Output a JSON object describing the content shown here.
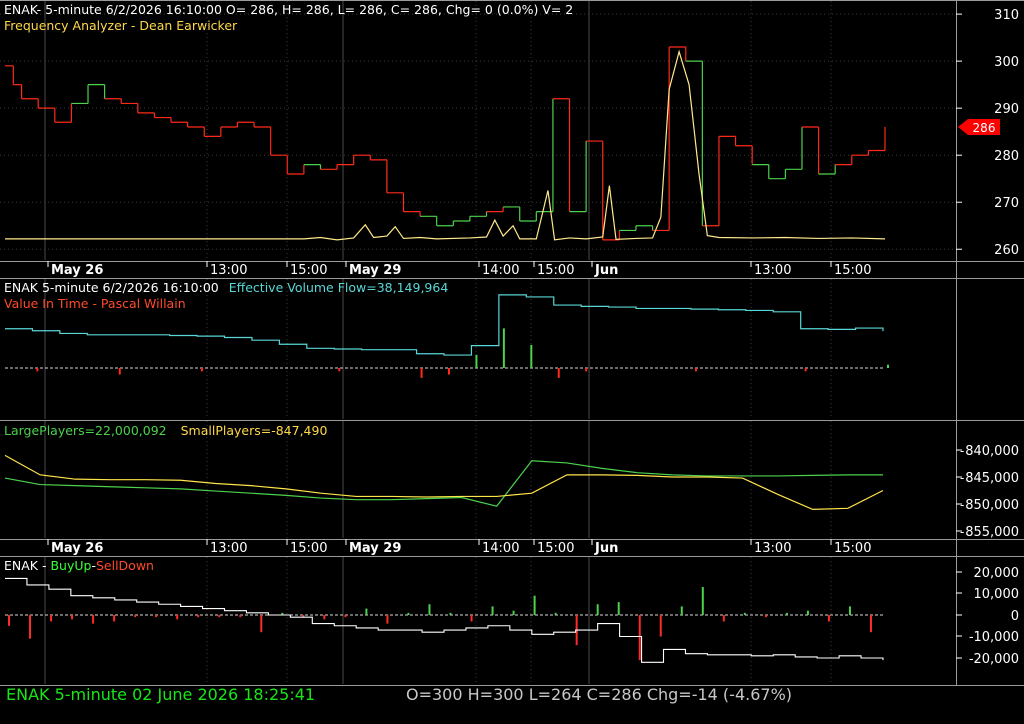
{
  "colors": {
    "background": "#000000",
    "grid": "#3a3a3a",
    "panel_border": "#9a9a9a",
    "axis_text": "#ffffff",
    "price_down": "#ff2a1a",
    "price_up": "#4cd24c",
    "frequency": "#ffe98a",
    "flow": "#5ad6d6",
    "large_players": "#4cd24c",
    "small_players": "#ffe44a",
    "buy_up": "#4cd24c",
    "sell_down": "#ff2a2a",
    "net_line": "#ffffff",
    "price_tag": "#ff0000",
    "status_symbol": "#19e619",
    "status_ohlc": "#c8c8c8"
  },
  "headers": {
    "price_line1": "ENAK- 5-minute 6/2/2026 16:10:00 O= 286, H= 286, L= 286, C= 286, Chg= 0 (0.0%) V= 2",
    "price_line2": "Frequency Analyzer - Dean Earwicker",
    "flow_prefix": "ENAK 5-minute  6/2/2026 16:10:00",
    "flow_value": "Effective Volume Flow=38,149,964",
    "flow_line2": "Value In Time - Pascal Willain",
    "players_large": "LargePlayers=22,000,092",
    "players_small": "SmallPlayers=-847,490",
    "buy_prefix": "ENAK - ",
    "buy_up": "BuyUp",
    "dash": "-",
    "sell_down": "SellDown"
  },
  "status": {
    "symbol_text": "ENAK  5-minute   02 June 2026 18:25:41",
    "ohlc_text": "O=300  H=300  L=264  C=286  Chg=-14 (-4.67%)"
  },
  "chart_data": [
    {
      "type": "line",
      "name": "price",
      "yticks": [
        260,
        270,
        280,
        290,
        300,
        310
      ],
      "ylim": [
        257.5,
        313
      ],
      "last_price_label": "286",
      "last_price": 286,
      "x_labels": [
        "May 26",
        "13:00",
        "15:00",
        "May 29",
        "14:00",
        "15:00",
        "Jun",
        "13:00",
        "15:00"
      ],
      "series": [
        {
          "points": [
            [
              0,
              299
            ],
            [
              0.5,
              299
            ],
            [
              0.5,
              295
            ],
            [
              1,
              295
            ],
            [
              1,
              292
            ],
            [
              2,
              292
            ],
            [
              2,
              290
            ],
            [
              3,
              290
            ],
            [
              3,
              287
            ],
            [
              4,
              287
            ],
            [
              4,
              291
            ],
            [
              5,
              291
            ],
            [
              5,
              295
            ],
            [
              6,
              295
            ],
            [
              6,
              292
            ],
            [
              7,
              292
            ],
            [
              7,
              291
            ],
            [
              8,
              291
            ],
            [
              8,
              289
            ],
            [
              9,
              289
            ],
            [
              9,
              288
            ],
            [
              10,
              288
            ],
            [
              10,
              287
            ],
            [
              11,
              287
            ],
            [
              11,
              286
            ],
            [
              12,
              286
            ],
            [
              12,
              284
            ],
            [
              13,
              284
            ],
            [
              13,
              286
            ],
            [
              14,
              286
            ],
            [
              14,
              287
            ],
            [
              15,
              287
            ],
            [
              15,
              286
            ],
            [
              16,
              286
            ],
            [
              16,
              280
            ],
            [
              17,
              280
            ],
            [
              17,
              276
            ],
            [
              18,
              276
            ],
            [
              18,
              278
            ],
            [
              19,
              278
            ],
            [
              19,
              277
            ],
            [
              20,
              277
            ],
            [
              20,
              278
            ],
            [
              21,
              278
            ],
            [
              21,
              280
            ],
            [
              22,
              280
            ],
            [
              22,
              279
            ],
            [
              23,
              279
            ],
            [
              23,
              272
            ],
            [
              24,
              272
            ],
            [
              24,
              268
            ],
            [
              25,
              268
            ],
            [
              25,
              267
            ],
            [
              26,
              267
            ],
            [
              26,
              265
            ],
            [
              27,
              265
            ],
            [
              27,
              266
            ],
            [
              28,
              266
            ],
            [
              28,
              267
            ],
            [
              29,
              267
            ],
            [
              29,
              268
            ],
            [
              30,
              268
            ],
            [
              30,
              269
            ],
            [
              31,
              269
            ],
            [
              31,
              266
            ],
            [
              32,
              266
            ],
            [
              32,
              268
            ],
            [
              33,
              268
            ],
            [
              33,
              292
            ],
            [
              34,
              292
            ],
            [
              34,
              268
            ],
            [
              35,
              268
            ],
            [
              35,
              283
            ],
            [
              36,
              283
            ],
            [
              36,
              262
            ],
            [
              37,
              262
            ],
            [
              37,
              264
            ],
            [
              38,
              264
            ],
            [
              38,
              265
            ],
            [
              39,
              265
            ],
            [
              39,
              264
            ],
            [
              40,
              264
            ],
            [
              40,
              303
            ],
            [
              41,
              303
            ],
            [
              41,
              300
            ],
            [
              42,
              300
            ],
            [
              42,
              265
            ],
            [
              43,
              265
            ],
            [
              43,
              284
            ],
            [
              44,
              284
            ],
            [
              44,
              282
            ],
            [
              45,
              282
            ],
            [
              45,
              278
            ],
            [
              46,
              278
            ],
            [
              46,
              275
            ],
            [
              47,
              275
            ],
            [
              47,
              277
            ],
            [
              48,
              277
            ],
            [
              48,
              286
            ],
            [
              49,
              286
            ],
            [
              49,
              276
            ],
            [
              50,
              276
            ],
            [
              50,
              278
            ],
            [
              51,
              278
            ],
            [
              51,
              280
            ],
            [
              52,
              280
            ],
            [
              52,
              281
            ],
            [
              53,
              281
            ],
            [
              53,
              286
            ]
          ],
          "colors": [
            "r",
            "r",
            "r",
            "r",
            "r",
            "g",
            "g",
            "r",
            "r",
            "r",
            "r",
            "r",
            "r",
            "r",
            "r",
            "r",
            "r",
            "r",
            "r",
            "g",
            "r",
            "r",
            "r",
            "r",
            "r",
            "r",
            "g",
            "g",
            "g",
            "g",
            "r",
            "g",
            "g",
            "g",
            "r",
            "g",
            "r",
            "r",
            "g",
            "g",
            "r",
            "r",
            "g",
            "r",
            "r",
            "r",
            "g",
            "g",
            "g",
            "r",
            "g",
            "r",
            "r",
            "r"
          ]
        }
      ]
    },
    {
      "type": "line",
      "name": "frequency",
      "points": [
        [
          0,
          262.2
        ],
        [
          18,
          262.2
        ],
        [
          19,
          262.5
        ],
        [
          20,
          262
        ],
        [
          21,
          262.4
        ],
        [
          21.7,
          265.2
        ],
        [
          22.2,
          262.5
        ],
        [
          23,
          262.8
        ],
        [
          23.5,
          264.8
        ],
        [
          24,
          262.3
        ],
        [
          25,
          262.5
        ],
        [
          26,
          262.2
        ],
        [
          28,
          262.4
        ],
        [
          29,
          262.6
        ],
        [
          29.5,
          266.2
        ],
        [
          30,
          262.8
        ],
        [
          30.6,
          265.0
        ],
        [
          31,
          262.2
        ],
        [
          32,
          262.2
        ],
        [
          32.7,
          272.5
        ],
        [
          33.1,
          262.0
        ],
        [
          34,
          262.4
        ],
        [
          35,
          262.2
        ],
        [
          36,
          262.6
        ],
        [
          36.4,
          273.5
        ],
        [
          36.8,
          262.1
        ],
        [
          38,
          262.3
        ],
        [
          39,
          262.4
        ],
        [
          39.5,
          266.8
        ],
        [
          40,
          294
        ],
        [
          40.6,
          302
        ],
        [
          41.2,
          295
        ],
        [
          41.8,
          276
        ],
        [
          42.3,
          262.9
        ],
        [
          43,
          262.5
        ],
        [
          45,
          262.4
        ],
        [
          47,
          262.5
        ],
        [
          49,
          262.3
        ],
        [
          51,
          262.4
        ],
        [
          53,
          262.2
        ]
      ]
    },
    {
      "type": "line",
      "name": "flow",
      "series": [
        {
          "name": "Effective Volume Flow",
          "values": [
            38.5,
            38.2,
            37.8,
            37.6,
            37.6,
            37.6,
            37.5,
            37.4,
            37.2,
            36.8,
            36.2,
            35.6,
            35.5,
            35.4,
            35.4,
            34.8,
            34.6,
            36.0,
            43.5,
            43.2,
            42.0,
            41.8,
            41.7,
            41.5,
            41.5,
            41.4,
            41.3,
            41.2,
            41.0,
            38.5,
            38.4,
            38.6,
            38.15
          ]
        }
      ],
      "bars": [
        0,
        -1,
        0,
        0,
        -2,
        0,
        0,
        -1,
        0,
        0,
        0,
        0,
        -1,
        0,
        0,
        -3,
        -2,
        4,
        12,
        7,
        -3,
        -1,
        0,
        0,
        0,
        -1,
        0,
        0,
        0,
        -1,
        0,
        0,
        1
      ]
    },
    {
      "type": "line",
      "name": "players",
      "yticks": [
        "840,000",
        "845,000",
        "850,000",
        "855,000"
      ],
      "series": [
        {
          "name": "LargePlayers",
          "values": [
            845.2,
            846.4,
            846.6,
            846.8,
            847.0,
            847.2,
            847.6,
            848.0,
            848.4,
            848.9,
            849.2,
            849.2,
            849.0,
            848.8,
            850.4,
            842.0,
            842.4,
            843.4,
            844.2,
            844.6,
            844.8,
            844.8,
            844.8,
            844.7,
            844.6,
            844.6
          ]
        },
        {
          "name": "SmallPlayers",
          "values": [
            841.0,
            844.6,
            845.4,
            845.5,
            845.5,
            845.6,
            846.2,
            846.6,
            847.2,
            848.0,
            848.6,
            848.6,
            848.7,
            848.6,
            848.6,
            848.0,
            844.6,
            844.6,
            844.7,
            845.0,
            845.0,
            845.2,
            848.2,
            851.0,
            850.8,
            847.5
          ]
        }
      ]
    },
    {
      "type": "bar",
      "name": "buyup-selldown",
      "yticks": [
        "20,000",
        "10,000",
        "0",
        "-10,000",
        "-20,000"
      ],
      "values": [
        -5,
        -11,
        -3,
        -2,
        -4,
        -3,
        -1,
        -1,
        -2,
        -1,
        -1,
        -1,
        -8,
        1,
        -1,
        -2,
        -1,
        3,
        -4,
        1,
        5,
        1,
        -3,
        4,
        2,
        9,
        1,
        -14,
        5,
        6,
        -21,
        -10,
        4,
        13,
        -3,
        1,
        -1,
        1,
        2,
        -3,
        4,
        -8
      ],
      "series": [
        {
          "name": "net",
          "values": [
            17,
            14,
            12,
            9,
            8,
            7,
            6,
            5,
            4,
            3,
            2,
            1,
            0,
            -1,
            -4,
            -5,
            -6,
            -7,
            -7,
            -8,
            -7,
            -6,
            -5,
            -7,
            -9,
            -8,
            -7,
            -4,
            -10,
            -22,
            -16,
            -18,
            -18.5,
            -18.5,
            -19,
            -18.5,
            -19.5,
            -20,
            -19,
            -20,
            -21
          ]
        }
      ]
    }
  ]
}
